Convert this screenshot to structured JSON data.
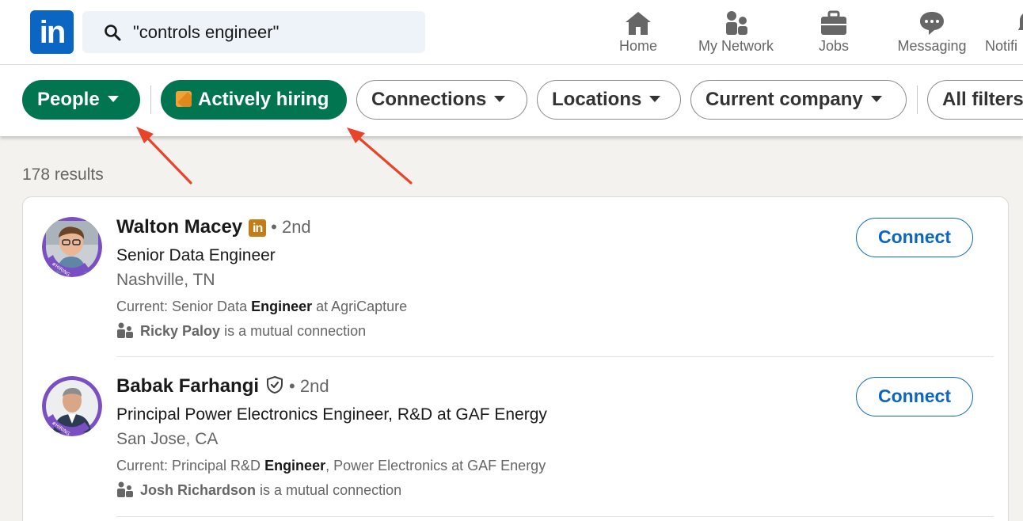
{
  "nav": {
    "logo_text": "in",
    "search_value": "\"controls engineer\"",
    "items": [
      {
        "label": "Home",
        "icon": "home-icon"
      },
      {
        "label": "My Network",
        "icon": "people-icon"
      },
      {
        "label": "Jobs",
        "icon": "briefcase-icon"
      },
      {
        "label": "Messaging",
        "icon": "chat-bubble-icon"
      },
      {
        "label": "Notifi",
        "icon": "bell-icon"
      }
    ]
  },
  "filters": {
    "people": "People",
    "actively_hiring": "Actively hiring",
    "connections": "Connections",
    "locations": "Locations",
    "current_company": "Current company",
    "all_filters": "All filters"
  },
  "colors": {
    "active_pill": "#01754f",
    "brand_blue": "#0a66c2",
    "annotation_arrow": "#e8432b"
  },
  "results_count": "178 results",
  "people": [
    {
      "name": "Walton Macey",
      "badge": "premium-linkedin-badge",
      "degree": "• 2nd",
      "headline": "Senior Data Engineer",
      "location": "Nashville, TN",
      "current_prefix": "Current: Senior Data ",
      "current_bold": "Engineer",
      "current_suffix": " at AgriCapture",
      "mutual_name": "Ricky Paloy",
      "mutual_suffix": " is a mutual connection",
      "button": "Connect",
      "frame_text": "#HIRING"
    },
    {
      "name": "Babak Farhangi",
      "badge": "verified-shield-badge",
      "degree": "• 2nd",
      "headline": "Principal Power Electronics Engineer, R&D at GAF Energy",
      "location": "San Jose, CA",
      "current_prefix": "Current: Principal R&D ",
      "current_bold": "Engineer",
      "current_suffix": ", Power Electronics at GAF Energy",
      "mutual_name": "Josh Richardson",
      "mutual_suffix": " is a mutual connection",
      "button": "Connect",
      "frame_text": "#HIRING"
    }
  ]
}
